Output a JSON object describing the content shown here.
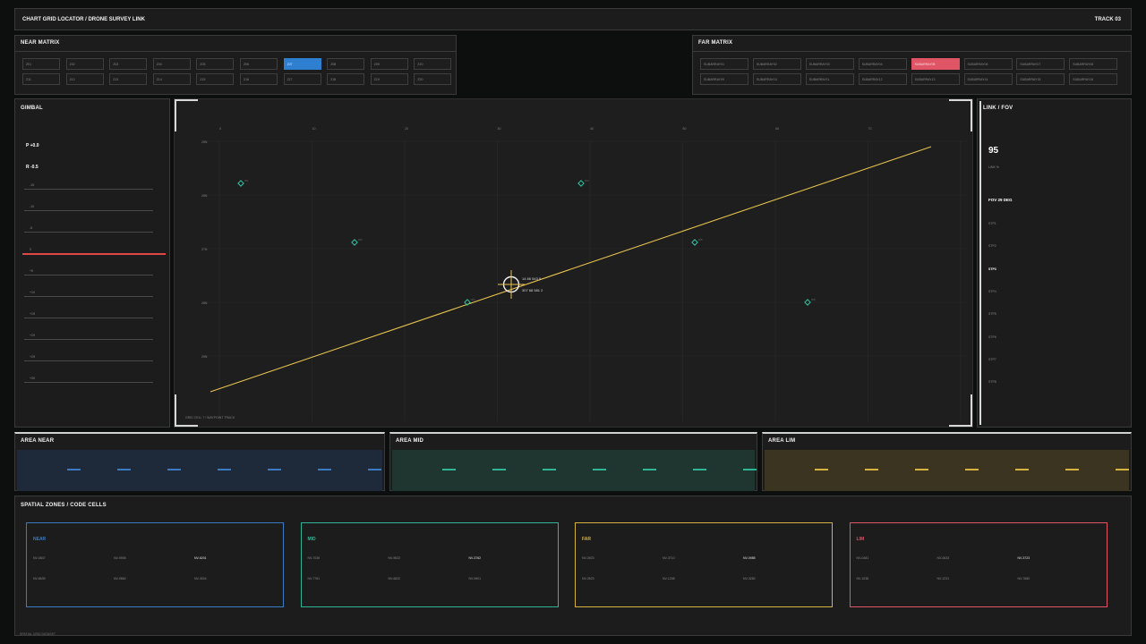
{
  "header": {
    "title": "CHART GRID LOCATOR  /  DRONE SURVEY LINK",
    "track": "TRACK 03"
  },
  "near_matrix": {
    "title": "NEAR MATRIX",
    "row1": [
      "Z01",
      "Z02",
      "Z03",
      "Z04",
      "Z05",
      "Z06",
      "Z07",
      "Z08",
      "Z09",
      "Z10"
    ],
    "row2": [
      "Z11",
      "Z12",
      "Z13",
      "Z14",
      "Z15",
      "Z16",
      "Z17",
      "Z18",
      "Z19",
      "Z20"
    ],
    "active_index": 6,
    "active_color": "#2f7fd0"
  },
  "far_matrix": {
    "title": "FAR MATRIX",
    "row1": [
      "SUBARRAY01",
      "SUBARRAY02",
      "SUBARRAY03",
      "SUBARRAY04",
      "SUBARRAY05",
      "SUBARRAY06",
      "SUBARRAY07",
      "SUBARRAY08"
    ],
    "row2": [
      "SUBARRAY09",
      "SUBARRAY10",
      "SUBARRAY11",
      "SUBARRAY12",
      "SUBARRAY13",
      "SUBARRAY14",
      "SUBARRAY15",
      "SUBARRAY16"
    ],
    "active_index": 4,
    "active_color": "#e05566"
  },
  "gimbal": {
    "title": "GIMBAL",
    "pitch": "P +0.0",
    "roll": "R -0.5",
    "ticks": [
      "-15",
      "-10",
      "-5",
      "0",
      "+5",
      "+10",
      "+15",
      "+20",
      "+25",
      "+30"
    ],
    "level_index": 3,
    "level_color": "#e04848"
  },
  "chart": {
    "top_ticks": [
      "0",
      "10",
      "20",
      "30",
      "40",
      "50",
      "60",
      "70"
    ],
    "left_ticks": [
      "25N",
      "26N",
      "27N",
      "28N",
      "29N"
    ],
    "footnote": "GRID CELL 7  /  WAYPOINT TRACK",
    "crosshair": {
      "line1": "14 86 543 9",
      "line2": "307 68 581 2"
    },
    "line_color": "#e6c24e",
    "marker_color": "#2ec4a0",
    "markers": [
      {
        "label": "W1"
      },
      {
        "label": "W2"
      },
      {
        "label": "W3"
      },
      {
        "label": "W4"
      },
      {
        "label": "W5"
      },
      {
        "label": "W6"
      }
    ]
  },
  "link": {
    "title": "LINK / FOV",
    "value": "95",
    "sub": "LINK %",
    "fov": "FOV 29 DEG",
    "rows": [
      "STP1",
      "STP2",
      "STP3",
      "STP4",
      "STP5",
      "STP6",
      "STP7",
      "STP8"
    ],
    "active_index": 2
  },
  "areas": [
    {
      "title": "AREA NEAR",
      "bg": "#1e2a39",
      "dash": "#3a7cc4",
      "count": 7
    },
    {
      "title": "AREA MID",
      "bg": "#1e3530",
      "dash": "#2fb595",
      "count": 7
    },
    {
      "title": "AREA LIM",
      "bg": "#3a3420",
      "dash": "#d6b240",
      "count": 7
    }
  ],
  "zones": {
    "title": "SPATIAL ZONES  /  CODE CELLS",
    "footer": "SPATIAL GRID DATASET",
    "items": [
      {
        "title": "NEAR",
        "color": "#3a7cc4",
        "codes": [
          "NV-0847",
          "NV-9905",
          "NV-6201",
          "NV-8639",
          "NV-0862",
          "NV-3024"
        ]
      },
      {
        "title": "MID",
        "color": "#2fb595",
        "codes": [
          "NV-7036",
          "NV-9622",
          "NV-3762",
          "NV-7761",
          "NV-6622",
          "NV-9901"
        ]
      },
      {
        "title": "FAR",
        "color": "#d6b240",
        "codes": [
          "NV-3923",
          "NV-3710",
          "NV-0985",
          "NV-3923",
          "NV-1208",
          "NV-3282"
        ]
      },
      {
        "title": "LIM",
        "color": "#e05566",
        "codes": [
          "NV-0481",
          "NV-0633",
          "NV-3723",
          "NV-1038",
          "NV-1231",
          "NV-7680"
        ]
      }
    ]
  }
}
